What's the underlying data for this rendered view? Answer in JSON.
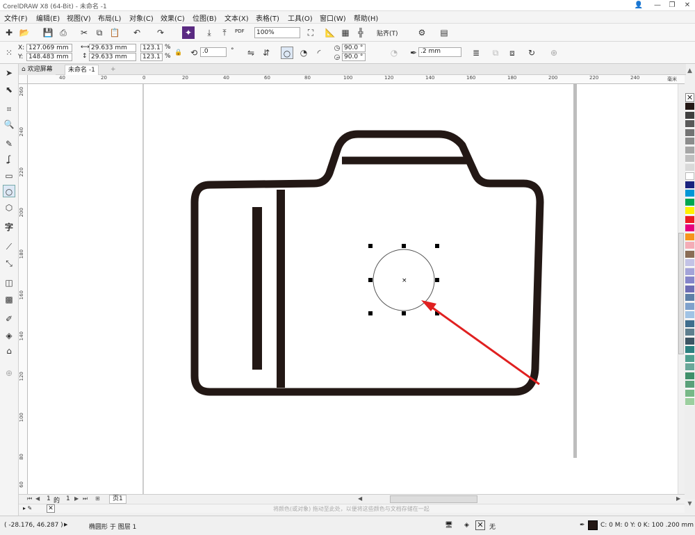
{
  "app": {
    "title": "CorelDRAW X8 (64-Bit) - 未命名 -1"
  },
  "menu": [
    "文件(F)",
    "编辑(E)",
    "视图(V)",
    "布局(L)",
    "对象(C)",
    "效果(C)",
    "位图(B)",
    "文本(X)",
    "表格(T)",
    "工具(O)",
    "窗口(W)",
    "帮助(H)"
  ],
  "toolbar": {
    "zoom": "100%",
    "snap_label": "贴齐(T)",
    "pdf_label": "PDF"
  },
  "props": {
    "x": "127.069 mm",
    "y": "148.483 mm",
    "width": "29.633 mm",
    "height": "29.633 mm",
    "scale_w": "123.1",
    "scale_h": "123.1",
    "pct": "%",
    "x_label": "X:",
    "y_label": "Y:",
    "rotation": ".0",
    "degree": "°",
    "angle_start": "90.0 °",
    "angle_end": "90.0 °",
    "outline_width": ".2 mm"
  },
  "tabs": {
    "welcome": "欢迎屏幕",
    "doc": "未命名 -1",
    "add": "+"
  },
  "ruler": {
    "h": [
      "40",
      "20",
      "0",
      "20",
      "40",
      "60",
      "80",
      "100",
      "120",
      "140",
      "160",
      "180",
      "200",
      "220",
      "240"
    ],
    "v": [
      "260",
      "240",
      "220",
      "200",
      "180",
      "160",
      "140",
      "120",
      "100",
      "80",
      "60"
    ],
    "unit": "毫米"
  },
  "pages": {
    "current": "1",
    "of_label": "的",
    "total": "1",
    "page_tab": "页1"
  },
  "dropbar": {
    "hint": "将颜色(或对象) 拖动至此处，以便将这些颜色与文档存储在一起"
  },
  "status": {
    "coords": "( -28.176, 46.287 )",
    "object_info": "椭圆形 于 图层 1",
    "fill_label": "无",
    "outline_info": "C: 0 M: 0 Y: 0 K: 100  .200 mm"
  },
  "palette": [
    "#231815",
    "#3f3f3f",
    "#595959",
    "#737373",
    "#8c8c8c",
    "#a6a6a6",
    "#bfbfbf",
    "#d9d9d9",
    "#ffffff",
    "#1a237e",
    "#0096d6",
    "#00a651",
    "#fff200",
    "#ed1c24",
    "#e6007e",
    "#f7941d",
    "#f4acb6",
    "#8a6d55",
    "#c3c3e6",
    "#a3a3d8",
    "#8585c9",
    "#6d6db4",
    "#5d7fa7",
    "#7ea1cc",
    "#a0c3e5",
    "#3f6e8e",
    "#5f7f8f",
    "#3d5564",
    "#2d8080",
    "#4f9f8f",
    "#6aa89a",
    "#3f8f6a",
    "#5aa07a",
    "#77b887",
    "#9ccf9f"
  ],
  "colors": {
    "accent": "#e02020",
    "outline": "#231815"
  }
}
